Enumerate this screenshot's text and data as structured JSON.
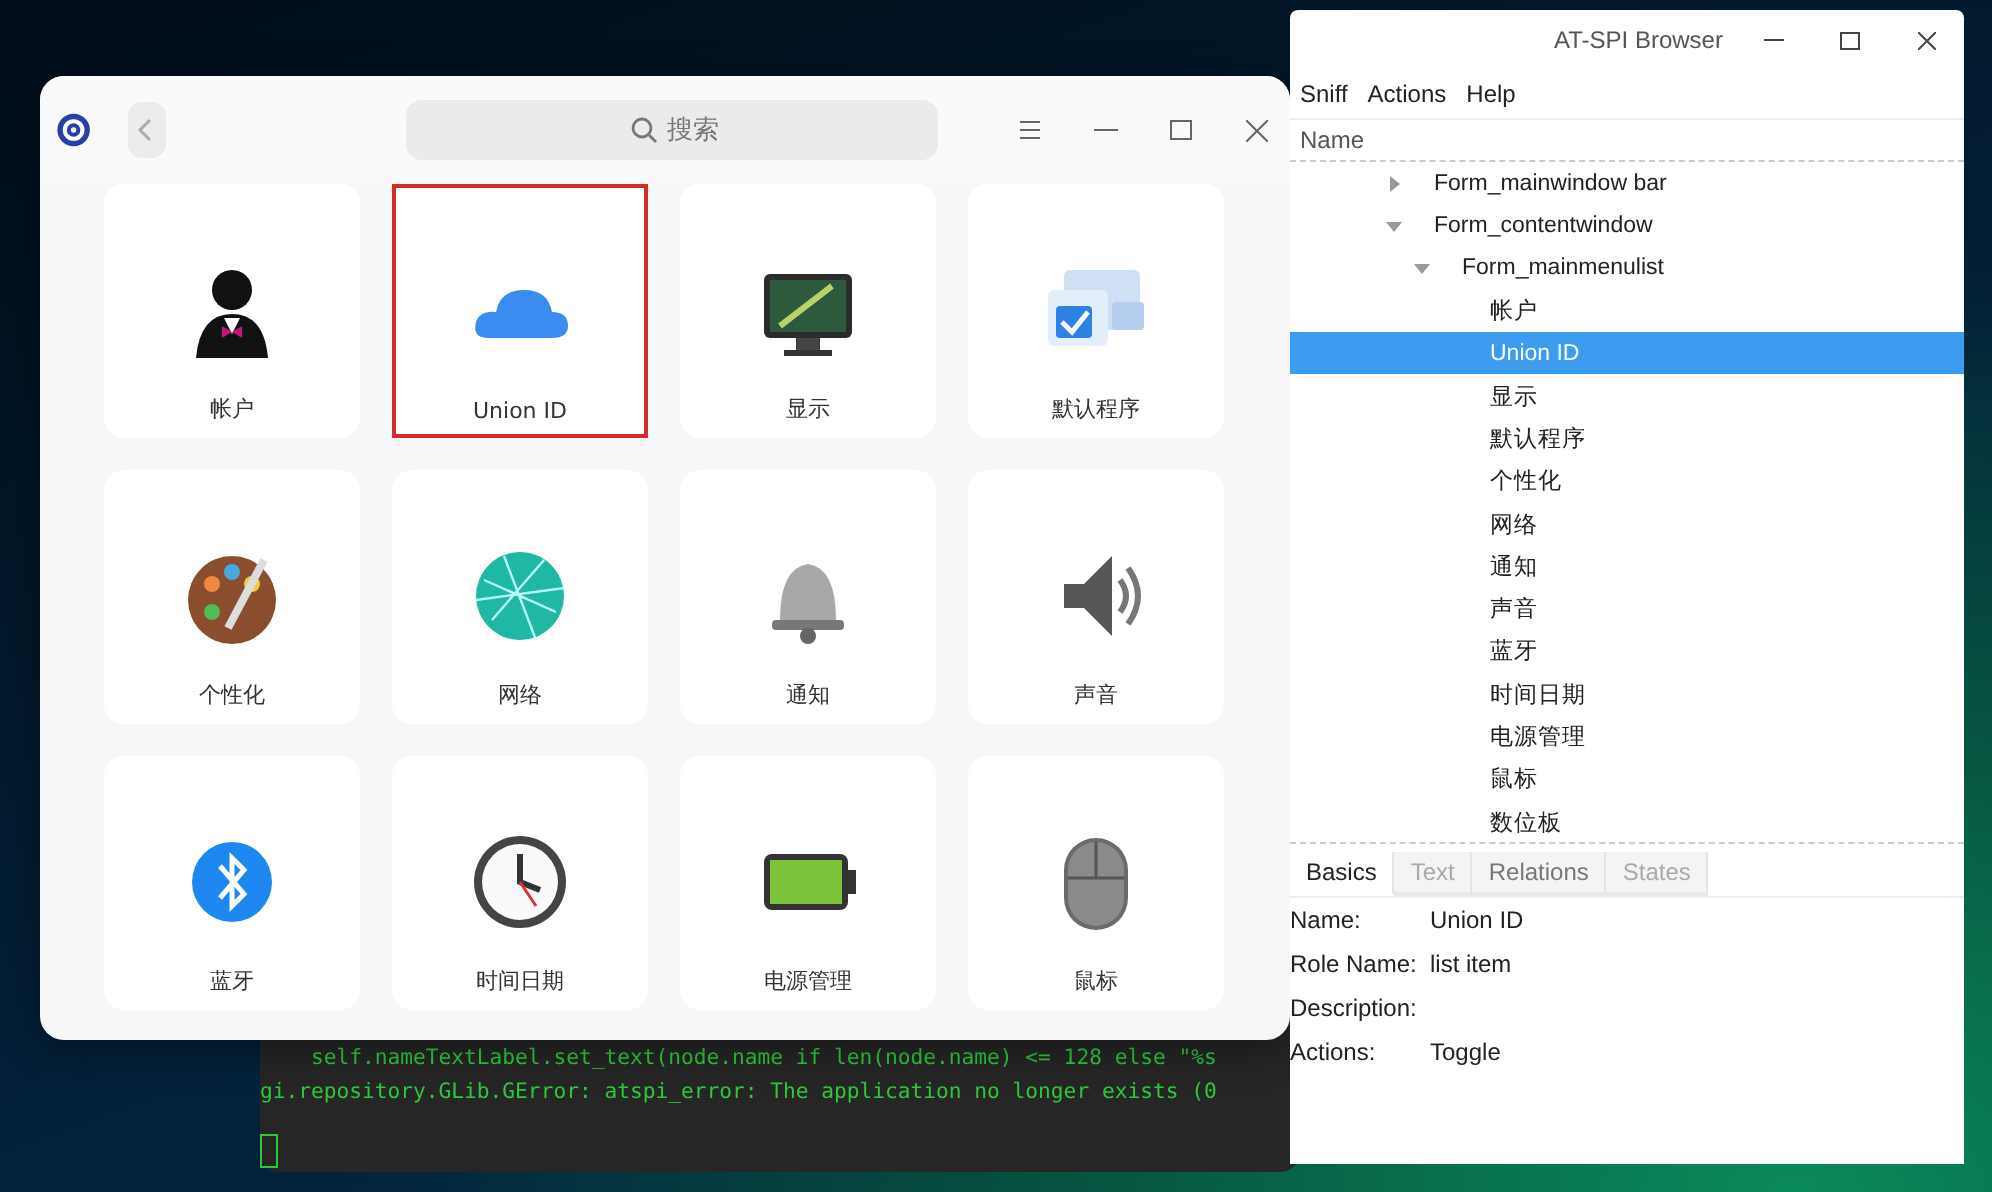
{
  "settings_window": {
    "search": {
      "placeholder": "搜索"
    },
    "modules": [
      {
        "label": "帐户",
        "selected": false
      },
      {
        "label": "Union ID",
        "selected": true
      },
      {
        "label": "显示",
        "selected": false
      },
      {
        "label": "默认程序",
        "selected": false
      },
      {
        "label": "个性化",
        "selected": false
      },
      {
        "label": "网络",
        "selected": false
      },
      {
        "label": "通知",
        "selected": false
      },
      {
        "label": "声音",
        "selected": false
      },
      {
        "label": "蓝牙",
        "selected": false
      },
      {
        "label": "时间日期",
        "selected": false
      },
      {
        "label": "电源管理",
        "selected": false
      },
      {
        "label": "鼠标",
        "selected": false
      }
    ]
  },
  "terminal": {
    "lines": [
      "    self.nameTextLabel.set_text(node.name if len(node.name) <= 128 else \"%s",
      "gi.repository.GLib.GError: atspi_error: The application no longer exists (0"
    ]
  },
  "atspi_browser": {
    "window": {
      "title": "AT-SPI Browser"
    },
    "menu": [
      "Sniff",
      "Actions",
      "Help"
    ],
    "tree_header": "Name",
    "tree": [
      {
        "label": "Form_mainwindow bar",
        "expanded": false,
        "selected": false
      },
      {
        "label": "Form_contentwindow",
        "expanded": true,
        "selected": false,
        "children": [
          {
            "label": "Form_mainmenulist",
            "expanded": true,
            "selected": false,
            "children": [
              {
                "label": "帐户",
                "selected": false
              },
              {
                "label": "Union ID",
                "selected": true
              },
              {
                "label": "显示",
                "selected": false
              },
              {
                "label": "默认程序",
                "selected": false
              },
              {
                "label": "个性化",
                "selected": false
              },
              {
                "label": "网络",
                "selected": false
              },
              {
                "label": "通知",
                "selected": false
              },
              {
                "label": "声音",
                "selected": false
              },
              {
                "label": "蓝牙",
                "selected": false
              },
              {
                "label": "时间日期",
                "selected": false
              },
              {
                "label": "电源管理",
                "selected": false
              },
              {
                "label": "鼠标",
                "selected": false
              },
              {
                "label": "数位板",
                "selected": false
              }
            ]
          }
        ]
      }
    ],
    "tabs": [
      {
        "label": "Basics",
        "selected": true,
        "disabled": false
      },
      {
        "label": "Text",
        "selected": false,
        "disabled": true
      },
      {
        "label": "Relations",
        "selected": false,
        "disabled": false
      },
      {
        "label": "States",
        "selected": false,
        "disabled": true
      }
    ],
    "details": [
      {
        "label": "Name:",
        "value": "Union ID"
      },
      {
        "label": "Role Name:",
        "value": "list item"
      },
      {
        "label": "Description:"
      },
      {
        "label": "Actions:",
        "value": "Toggle"
      }
    ]
  }
}
